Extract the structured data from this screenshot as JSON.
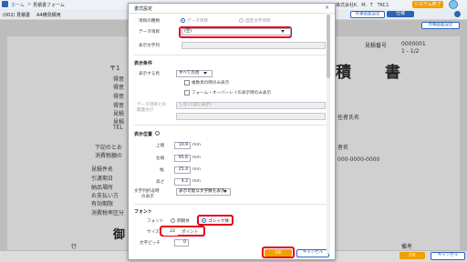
{
  "app": {
    "home_label": "ホーム",
    "breadcrumb_sep": ">",
    "page_label": "見積書フォーム",
    "company_info": "株式会社K．M．T　TKC1",
    "system_exit_label": "システム終了",
    "form_code": "(002) 見積書",
    "form_variant": "A4横見積用",
    "toolbar_buttons": [
      "設定",
      "書式変更",
      "有書画面設定",
      "仕様"
    ],
    "pdf_label": "見積画面設定",
    "sidebar_label": "基板",
    "bottom_ok": "OK",
    "bottom_cancel": "キャンセル"
  },
  "background_doc": {
    "number_label": "見積番号",
    "number_value": "0000001",
    "page_value": "1 - 1/2",
    "title_fragment": "積　書",
    "postal": "〒1",
    "lines": [
      "得意",
      "得意",
      "得意",
      "得意",
      "見積",
      "見積",
      "TEL"
    ],
    "notes": [
      "下記のとお",
      "消費税額の"
    ],
    "fields": [
      "見積件名",
      "引渡期日",
      "納品場所",
      "お支払い方",
      "有効期限",
      "消費税率区分"
    ],
    "right_info": [
      "任者氏名",
      "者名",
      "000-0000-0000"
    ],
    "recipient": "御",
    "row_label": "行",
    "remarks_label": "備考"
  },
  "dialog": {
    "title": "書式設定",
    "close_icon": "×",
    "item_type_label": "項目の種類",
    "item_type_options": [
      "データ項目",
      "固定文字項目"
    ],
    "data_item_label": "データ項目",
    "data_item_value": "(空)",
    "display_text_label": "表示文字列",
    "display_text_value": "",
    "display_condition_section": "表示条件",
    "display_page_label": "表示する頁",
    "display_page_value": "すべての頁",
    "checkbox_multipage": "複数頁の時のみ表示",
    "checkbox_overlay": "フォーム・オーバーレイの表示時のみ表示",
    "related_label_line1": "データ項目との",
    "related_label_line2": "関連付け",
    "related_value": "しない(常に表示)",
    "position_section": "表示位置",
    "top_label": "上端",
    "top_value": "10.9",
    "left_label": "左端",
    "left_value": "95.6",
    "width_label": "幅",
    "width_value": "25.4",
    "height_label": "高さ",
    "height_value": "4.2",
    "unit": "mm",
    "overflow_label_line1": "文字列折返時",
    "overflow_label_line2": "の表示",
    "overflow_value": "表示可能な文字数を表示",
    "font_section": "フォント",
    "font_label": "フォント",
    "font_options": [
      "明朝体",
      "ゴシック体"
    ],
    "size_label": "サイズ",
    "size_value": "22",
    "size_unit": "ポイント",
    "pitch_label": "文字ピッチ",
    "pitch_value": "0",
    "ok_label": "OK",
    "cancel_label": "キャンセル"
  },
  "colors": {
    "accent": "#2f63b5",
    "ok_button": "#f0a000",
    "highlight": "#e3001b"
  }
}
